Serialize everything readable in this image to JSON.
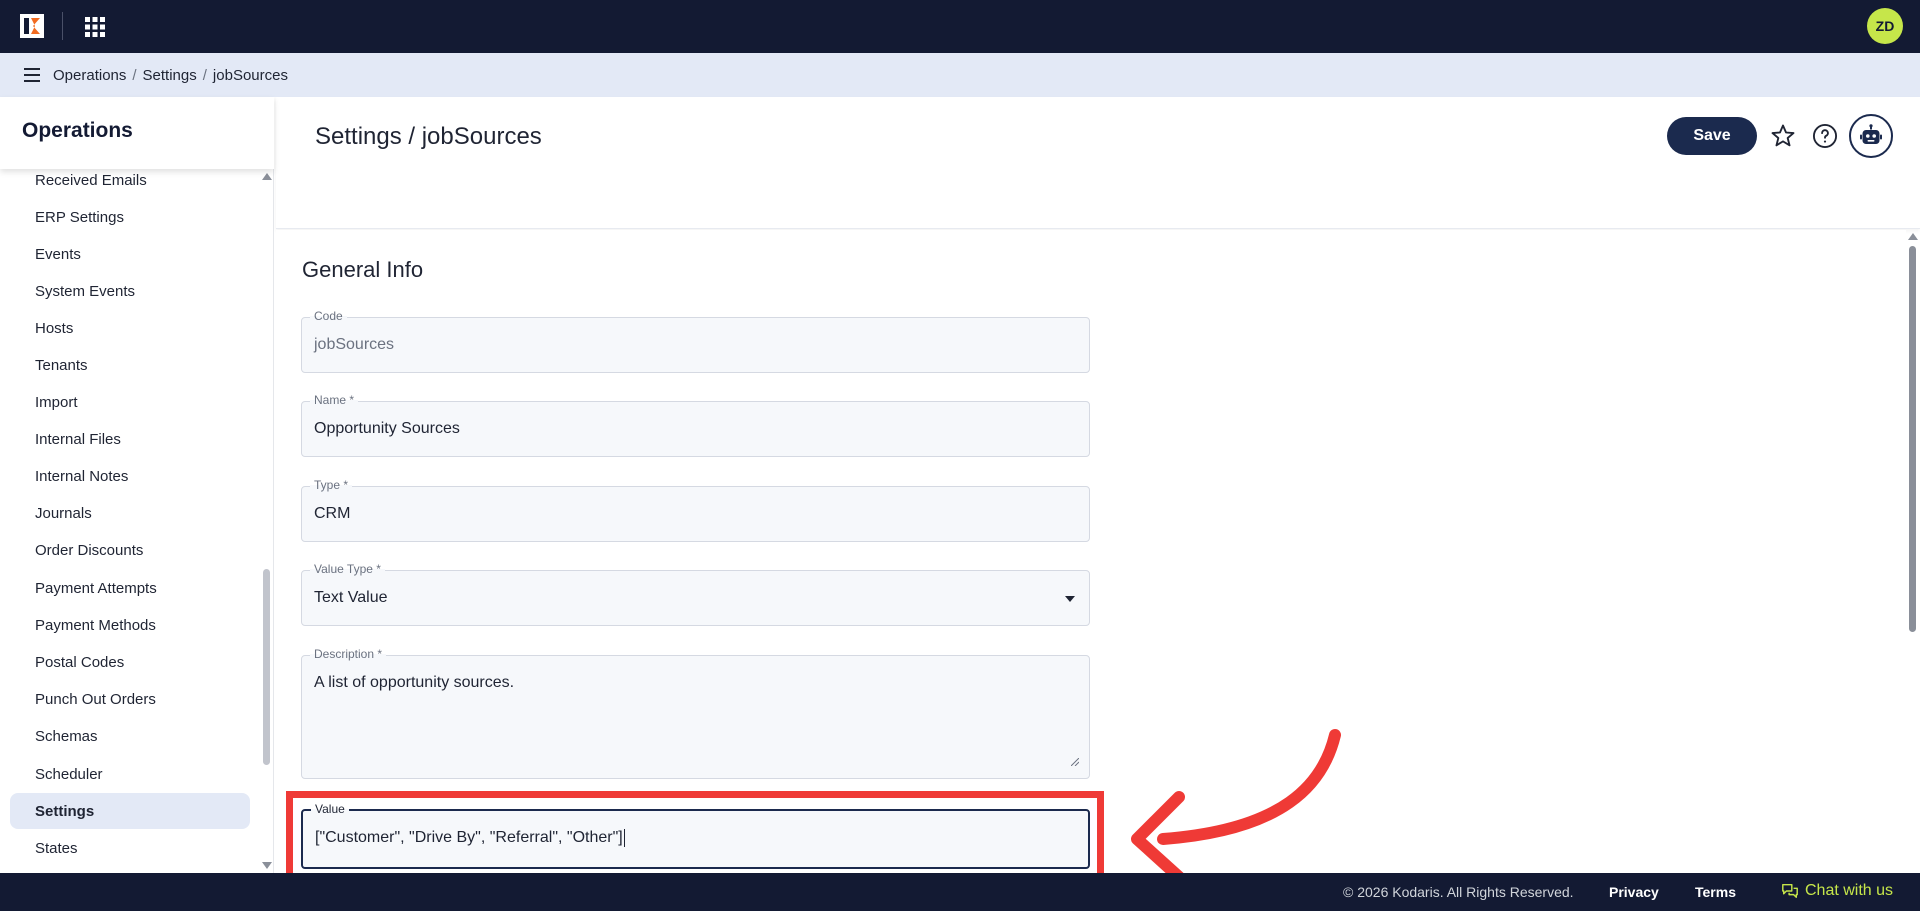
{
  "topbar": {
    "avatar_initials": "ZD",
    "accent_color": "#c6e64a",
    "bar_color": "#131a33",
    "icons": [
      "kodaris-logo-icon",
      "apps-grid-icon"
    ]
  },
  "breadcrumb": {
    "items": [
      "Operations",
      "Settings",
      "jobSources"
    ],
    "separator": "/"
  },
  "sidebar": {
    "title": "Operations",
    "items": [
      {
        "label": "Received Emails"
      },
      {
        "label": "ERP Settings"
      },
      {
        "label": "Events"
      },
      {
        "label": "System Events"
      },
      {
        "label": "Hosts"
      },
      {
        "label": "Tenants"
      },
      {
        "label": "Import"
      },
      {
        "label": "Internal Files"
      },
      {
        "label": "Internal Notes"
      },
      {
        "label": "Journals"
      },
      {
        "label": "Order Discounts"
      },
      {
        "label": "Payment Attempts"
      },
      {
        "label": "Payment Methods"
      },
      {
        "label": "Postal Codes"
      },
      {
        "label": "Punch Out Orders"
      },
      {
        "label": "Schemas"
      },
      {
        "label": "Scheduler"
      },
      {
        "label": "Settings",
        "active": true
      },
      {
        "label": "States"
      }
    ]
  },
  "header": {
    "title": "Settings / jobSources",
    "save_label": "Save",
    "icons": [
      "star-icon",
      "help-icon",
      "robot-icon"
    ]
  },
  "form": {
    "section_title": "General Info",
    "code": {
      "label": "Code",
      "value": "jobSources"
    },
    "name": {
      "label": "Name *",
      "value": "Opportunity Sources"
    },
    "type": {
      "label": "Type *",
      "value": "CRM"
    },
    "value_type": {
      "label": "Value Type *",
      "value": "Text Value"
    },
    "description": {
      "label": "Description *",
      "value": "A list of opportunity sources."
    },
    "value": {
      "label": "Value",
      "value": "[\"Customer\", \"Drive By\", \"Referral\", \"Other\"]"
    }
  },
  "annotation": {
    "color": "#ef3a36"
  },
  "footer": {
    "copyright": "© 2026 Kodaris. All Rights Reserved.",
    "privacy": "Privacy",
    "terms": "Terms",
    "chat": "Chat with us"
  }
}
